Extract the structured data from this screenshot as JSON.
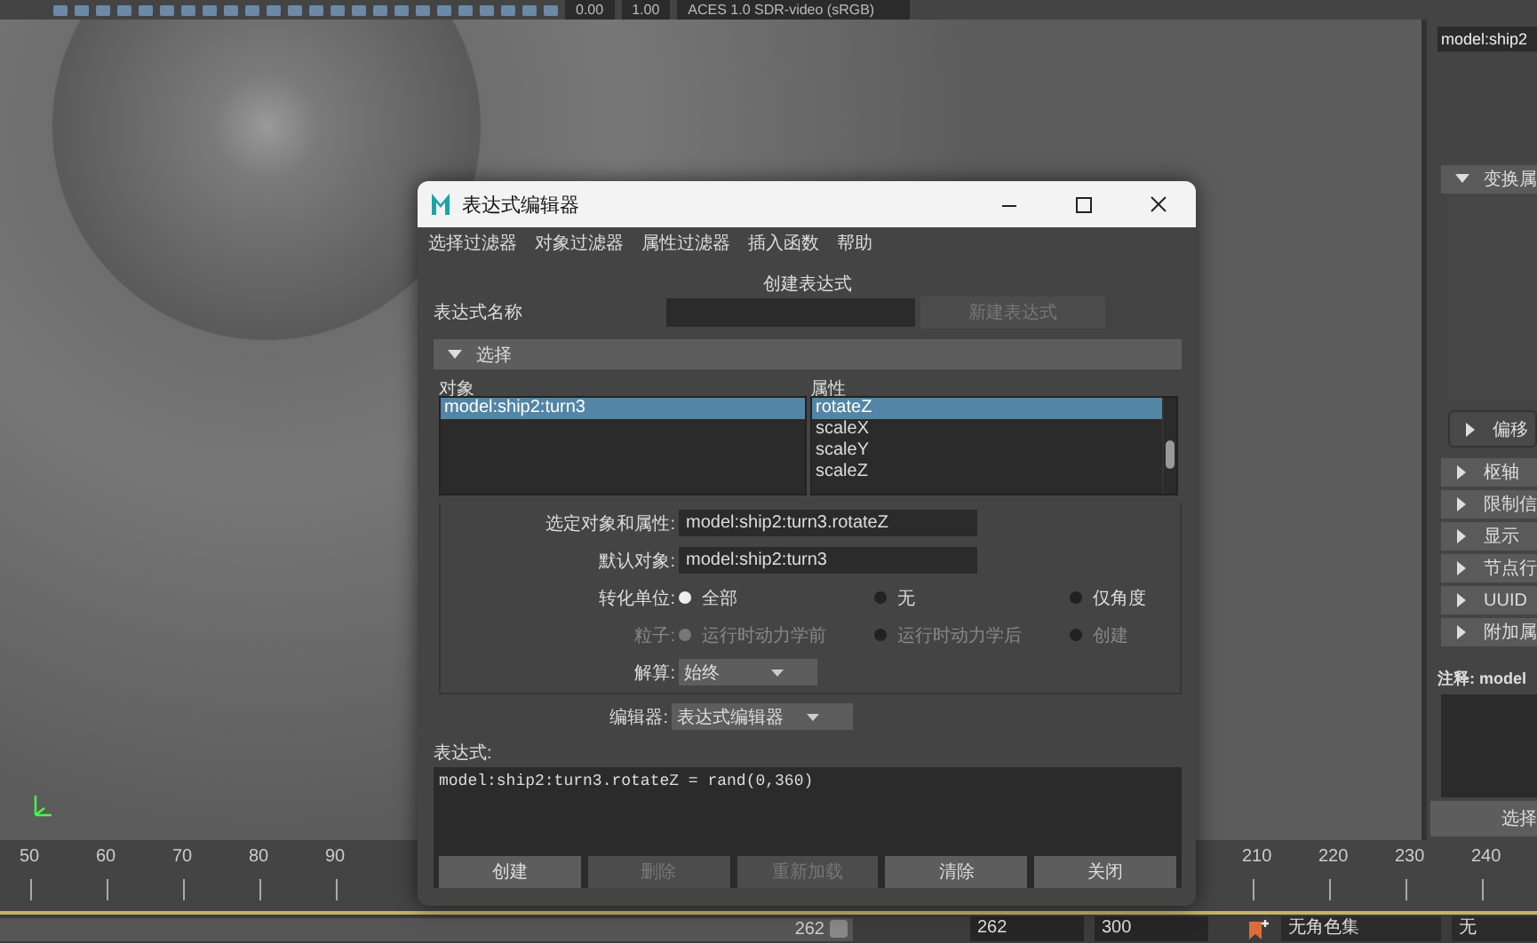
{
  "toolbar": {
    "values": [
      "0.00",
      "1.00"
    ],
    "color_space": "ACES 1.0 SDR-video (sRGB)"
  },
  "right_panel": {
    "node_field": "model:ship2",
    "sections": [
      {
        "label": "变换属",
        "expanded": true,
        "children": [
          {
            "label": "偏移",
            "expanded": false
          }
        ]
      },
      {
        "label": "枢轴",
        "expanded": false
      },
      {
        "label": "限制信",
        "expanded": false
      },
      {
        "label": "显示",
        "expanded": false
      },
      {
        "label": "节点行",
        "expanded": false
      },
      {
        "label": "UUID",
        "expanded": false
      },
      {
        "label": "附加属",
        "expanded": false
      }
    ],
    "notes_label": "注释: model",
    "select_button": "选择"
  },
  "timeline": {
    "ticks": [
      "50",
      "60",
      "70",
      "80",
      "90",
      "210",
      "220",
      "230",
      "240"
    ]
  },
  "range_bar": {
    "level": 1,
    "current": "262",
    "start": "262",
    "end": "300",
    "character_set": "无角色集",
    "cut_label": "无"
  },
  "dialog": {
    "title": "表达式编辑器",
    "menu": [
      "选择过滤器",
      "对象过滤器",
      "属性过滤器",
      "插入函数",
      "帮助"
    ],
    "heading": "创建表达式",
    "name_label": "表达式名称",
    "new_button": {
      "label": "新建表达式",
      "disabled": true
    },
    "section": {
      "label": "选择",
      "expanded": true
    },
    "objects": {
      "label": "对象",
      "items": [
        {
          "text": "model:ship2:turn3",
          "selected": true
        }
      ]
    },
    "attributes": {
      "label": "属性",
      "items": [
        {
          "text": "rotateZ",
          "selected": true
        },
        {
          "text": "scaleX",
          "selected": false
        },
        {
          "text": "scaleY",
          "selected": false
        },
        {
          "text": "scaleZ",
          "selected": false
        }
      ]
    },
    "fields": [
      {
        "label": "选定对象和属性:",
        "value": "model:ship2:turn3.rotateZ"
      },
      {
        "label": "默认对象:",
        "value": "model:ship2:turn3"
      }
    ],
    "radio_groups": [
      {
        "label": "转化单位:",
        "disabled": false,
        "options": [
          {
            "label": "全部",
            "selected": true
          },
          {
            "label": "无",
            "selected": false
          },
          {
            "label": "仅角度",
            "selected": false
          }
        ]
      },
      {
        "label": "粒子:",
        "disabled": true,
        "options": [
          {
            "label": "运行时动力学前",
            "selected": true
          },
          {
            "label": "运行时动力学后",
            "selected": false
          },
          {
            "label": "创建",
            "selected": false
          }
        ]
      }
    ],
    "solver": {
      "label": "解算:",
      "value": "始终"
    },
    "editor": {
      "label": "编辑器:",
      "value": "表达式编辑器"
    },
    "expression": {
      "label": "表达式:",
      "text": "model:ship2:turn3.rotateZ = rand(0,360)"
    },
    "buttons": [
      {
        "label": "创建",
        "disabled": false
      },
      {
        "label": "删除",
        "disabled": true
      },
      {
        "label": "重新加载",
        "disabled": true
      },
      {
        "label": "清除",
        "disabled": false
      },
      {
        "label": "关闭",
        "disabled": false
      }
    ]
  }
}
